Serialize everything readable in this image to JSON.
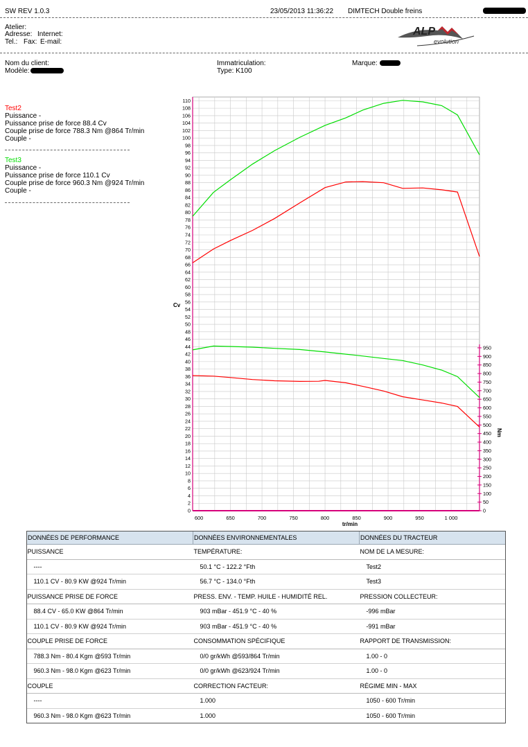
{
  "header": {
    "version": "SW REV 1.0.3",
    "datetime": "23/05/2013 11:36:22",
    "test_name": "DIMTECH Double freins",
    "atelier_label": "Atelier:",
    "adresse_label": "Adresse:",
    "internet_label": "Internet:",
    "tel_label": "Tel.:",
    "fax_label": "Fax:",
    "email_label": "E-mail:",
    "client_label": "Nom du client:",
    "model_label": "Modèle:",
    "immat_label": "Immatriculation:",
    "type_label": "Type: K100",
    "marque_label": "Marque:"
  },
  "logo": {
    "top_text": "ALP",
    "sub_text": "evolution"
  },
  "tests": [
    {
      "name": "Test2",
      "color": "#ff0000",
      "puissance": "Puissance -",
      "pto": "Puissance prise de force 88.4 Cv",
      "couple_pto": "Couple prise de force 788.3 Nm   @864 Tr/min",
      "couple": "Couple -"
    },
    {
      "name": "Test3",
      "color": "#00dd00",
      "puissance": "Puissance -",
      "pto": "Puissance prise de force 110.1 Cv",
      "couple_pto": "Couple prise de force 960.3 Nm   @924 Tr/min",
      "couple": "Couple -"
    }
  ],
  "chart_data": {
    "type": "line",
    "xlabel": "tr/min",
    "ylabel": "Cv",
    "y2label": "Nm",
    "xlim": [
      590,
      1045
    ],
    "ylim": [
      0,
      111
    ],
    "y2lim": [
      0,
      970
    ],
    "x_ticks": [
      600,
      650,
      700,
      750,
      800,
      850,
      900,
      950,
      1000
    ],
    "y_ticks": [
      0,
      2,
      4,
      6,
      8,
      10,
      12,
      14,
      16,
      18,
      20,
      22,
      24,
      26,
      28,
      30,
      32,
      34,
      36,
      38,
      40,
      42,
      44,
      46,
      48,
      50,
      52,
      54,
      56,
      58,
      60,
      62,
      64,
      66,
      68,
      70,
      72,
      74,
      76,
      78,
      80,
      82,
      84,
      86,
      88,
      90,
      92,
      94,
      96,
      98,
      100,
      102,
      104,
      106,
      108,
      110
    ],
    "y2_ticks": [
      0,
      50,
      100,
      150,
      200,
      250,
      300,
      350,
      400,
      450,
      500,
      550,
      600,
      650,
      700,
      750,
      800,
      850,
      900,
      950
    ],
    "grid": true,
    "series": [
      {
        "name": "Test2",
        "axis": "left",
        "color": "#ff0000",
        "x": [
          590,
          623,
          650,
          685,
          720,
          760,
          800,
          833,
          860,
          893,
          923,
          955,
          985,
          1010,
          1045
        ],
        "y": [
          66.5,
          70.2,
          72.5,
          75.2,
          78.4,
          82.6,
          86.7,
          88.2,
          88.3,
          88.0,
          86.5,
          86.6,
          86.1,
          85.5,
          68.2
        ]
      },
      {
        "name": "Test3",
        "axis": "left",
        "color": "#00dd00",
        "x": [
          590,
          623,
          650,
          685,
          720,
          760,
          800,
          833,
          860,
          893,
          923,
          955,
          985,
          1010,
          1045
        ],
        "y": [
          79.0,
          85.4,
          88.8,
          93.0,
          96.6,
          100.2,
          103.4,
          105.4,
          107.5,
          109.3,
          110.1,
          109.7,
          108.7,
          106.2,
          95.5
        ]
      },
      {
        "name": "Test2",
        "axis": "right",
        "color": "#ff0000",
        "x": [
          590,
          623,
          650,
          685,
          720,
          760,
          790,
          800,
          833,
          860,
          893,
          923,
          955,
          985,
          1010,
          1045
        ],
        "y": [
          788.3,
          785,
          777,
          765,
          758,
          754,
          755,
          760,
          746,
          725,
          698,
          665,
          646,
          628,
          608,
          488
        ]
      },
      {
        "name": "Test3",
        "axis": "right",
        "color": "#00dd00",
        "x": [
          590,
          623,
          650,
          685,
          720,
          760,
          800,
          833,
          860,
          893,
          923,
          955,
          985,
          1010,
          1045
        ],
        "y": [
          938,
          960.3,
          958,
          954,
          947,
          940,
          926,
          913,
          902,
          888,
          876,
          850,
          820,
          782,
          660
        ]
      }
    ]
  },
  "table": {
    "headers": [
      "DONNÉES DE PERFORMANCE",
      "DONNÉES ENVIRONNEMENTALES",
      "DONNÉES DU TRACTEUR"
    ],
    "rows": [
      {
        "kind": "sec",
        "cells": [
          "PUISSANCE",
          "TEMPÉRATURE:",
          "NOM DE LA MESURE:"
        ]
      },
      {
        "kind": "val",
        "cells": [
          "----",
          "50.1 °C - 122.2 °Fth",
          "Test2"
        ]
      },
      {
        "kind": "val",
        "cells": [
          "110.1 CV - 80.9 KW  @924 Tr/min",
          "56.7 °C - 134.0 °Fth",
          "Test3"
        ]
      },
      {
        "kind": "sec",
        "cells": [
          "PUISSANCE PRISE DE FORCE",
          "PRESS. ENV. - TEMP. HUILE - HUMIDITÉ REL.",
          "PRESSION COLLECTEUR:"
        ]
      },
      {
        "kind": "val",
        "cells": [
          "88.4 CV - 65.0 KW  @864 Tr/min",
          "903 mBar - 451.9 °C - 40 %",
          "-996 mBar"
        ]
      },
      {
        "kind": "val",
        "cells": [
          "110.1 CV - 80.9 KW  @924 Tr/min",
          "903 mBar - 451.9 °C - 40 %",
          "-991 mBar"
        ]
      },
      {
        "kind": "sec",
        "cells": [
          "COUPLE PRISE DE FORCE",
          "CONSOMMATION SPÉCIFIQUE",
          "RAPPORT DE TRANSMISSION:"
        ]
      },
      {
        "kind": "val",
        "cells": [
          "788.3 Nm - 80.4 Kgm  @593 Tr/min",
          "0/0 gr/kWh @593/864 Tr/min",
          "1.00 - 0"
        ]
      },
      {
        "kind": "val",
        "cells": [
          "960.3 Nm - 98.0 Kgm  @623 Tr/min",
          "0/0 gr/kWh @623/924 Tr/min",
          "1.00 - 0"
        ]
      },
      {
        "kind": "sec",
        "cells": [
          "COUPLE",
          "CORRECTION FACTEUR:",
          "RÉGIME MIN - MAX"
        ]
      },
      {
        "kind": "val",
        "cells": [
          "----",
          "1.000",
          "1050 - 600 Tr/min"
        ]
      },
      {
        "kind": "val",
        "cells": [
          "960.3 Nm - 98.0 Kgm  @623 Tr/min",
          "1.000",
          "1050 - 600 Tr/min"
        ]
      }
    ]
  }
}
